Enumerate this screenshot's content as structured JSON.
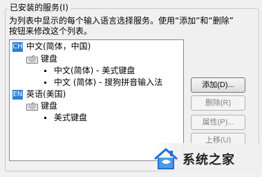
{
  "group_title": "已安装的服务(I)",
  "description": {
    "line1": "为列表中显示的每个输入语言选择服务。使用“添加”和“删除”",
    "line2": "按钮来修改这个列表。"
  },
  "tree": {
    "languages": [
      {
        "badge": "CH",
        "label": "中文(简体，中国)",
        "keyboard_label": "键盘",
        "services": [
          "中文(简体) - 美式键盘",
          "中文 (简体) - 搜狗拼音输入法"
        ]
      },
      {
        "badge": "EN",
        "label": "英语(美国)",
        "keyboard_label": "键盘",
        "services": [
          "美式键盘"
        ]
      }
    ]
  },
  "buttons": {
    "add": "添加(D)...",
    "remove": "删除(R)",
    "properties": "属性(P)...",
    "move_up": "上移(U)"
  },
  "watermark": {
    "text": "系统之家"
  },
  "colors": {
    "badge_blue": "#2f7ed8",
    "dialog_bg": "#f0f0f0"
  }
}
